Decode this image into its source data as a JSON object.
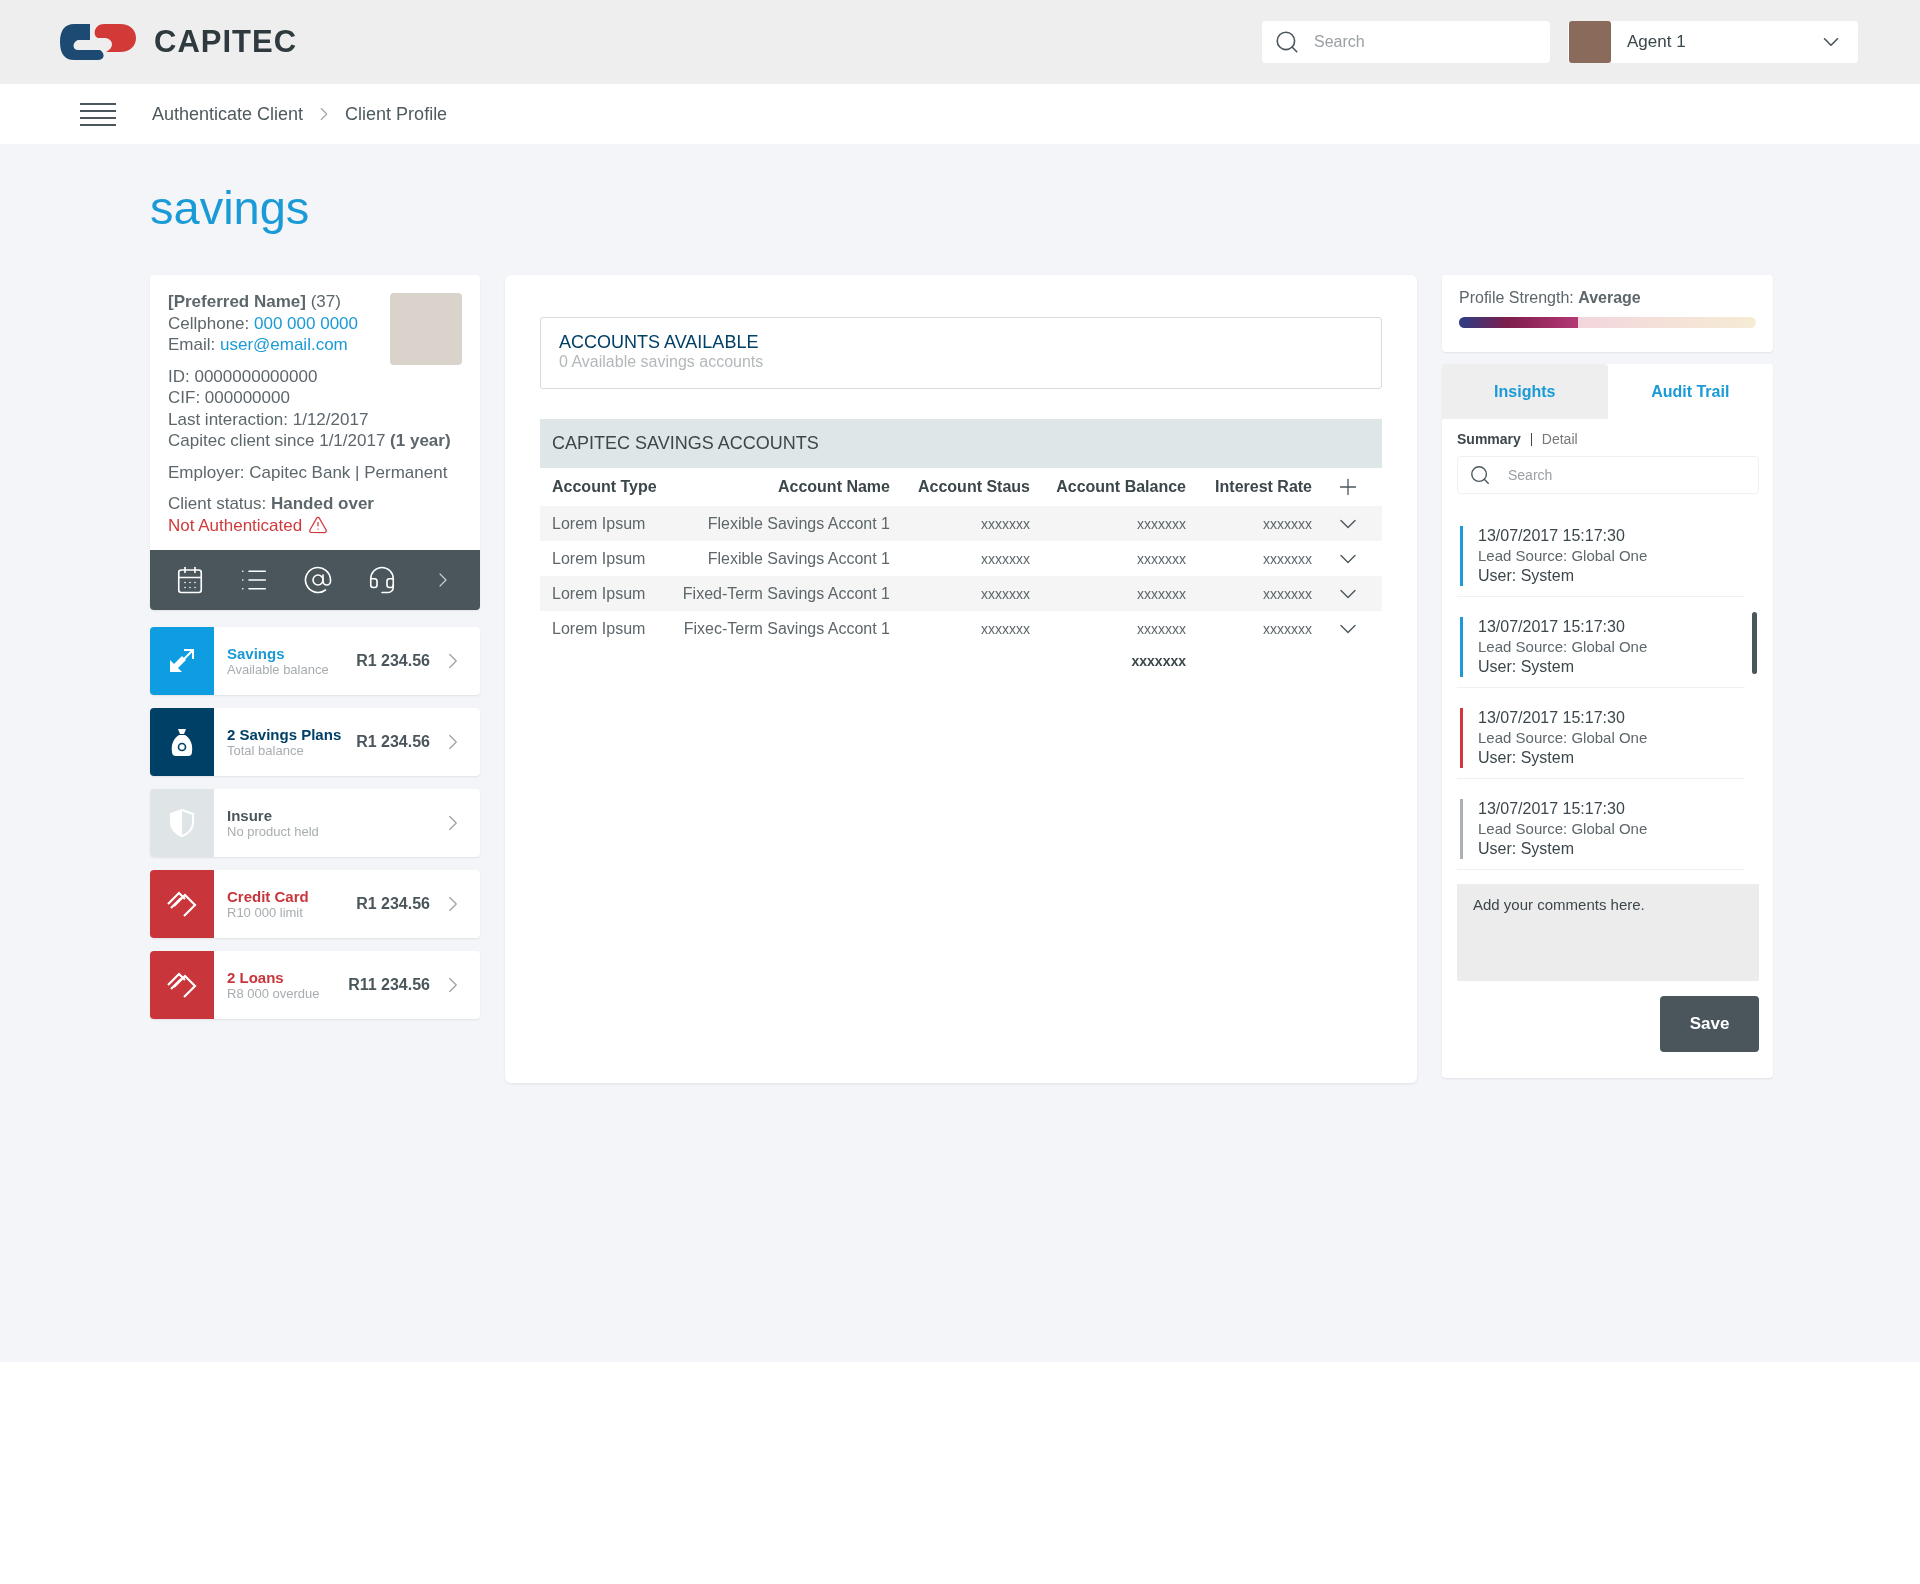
{
  "header": {
    "logo_text": "CAPITEC",
    "search": {
      "placeholder": "Search"
    },
    "agent": {
      "name": "Agent 1"
    }
  },
  "breadcrumb": [
    "Authenticate Client",
    "Client Profile"
  ],
  "page_title": "savings",
  "client": {
    "name_line": "**[Preferred Name]** (37)",
    "contacts": [
      {
        "label": "Cellphone:",
        "value": "000 000 0000"
      },
      {
        "label": "Email:",
        "value": "user@email.com"
      }
    ],
    "details": [
      "ID: 0000000000000",
      "CIF: 000000000",
      "Last interaction: 1/12/2017",
      "Capitec client since 1/1/2017 **(1 year)**"
    ],
    "employer": "Employer: Capitec Bank | Permanent",
    "status": "Client status: **Handed over**",
    "authenticated": false,
    "auth_text": "Not Authenticated"
  },
  "products": [
    {
      "kind": "savings",
      "color": "#0d9de0",
      "title": "Savings",
      "subtitle": "Available balance",
      "amount": "R1 234.56"
    },
    {
      "kind": "plans",
      "color": "#003f66",
      "title": "2 Savings Plans",
      "subtitle": "Total balance",
      "amount": "R1 234.56"
    },
    {
      "kind": "insure",
      "color": "#dfe5e7",
      "title": "Insure",
      "subtitle": "No product held"
    },
    {
      "kind": "card",
      "color": "#c8353a",
      "title": "Credit Card",
      "subtitle": "R10 000 limit",
      "amount": "R1 234.56"
    },
    {
      "kind": "loan",
      "color": "#c8353a",
      "title": "2 Loans",
      "subtitle": "R8 000 overdue",
      "amount": "R11 234.56"
    }
  ],
  "accounts_available": {
    "title": "ACCOUNTS AVAILABLE",
    "subtitle": "0 Available savings accounts"
  },
  "table": {
    "title": "CAPITEC SAVINGS ACCOUNTS",
    "columns": [
      "Account Type",
      "Account Name",
      "Account Staus",
      "Account Balance",
      "Interest Rate"
    ],
    "rows": [
      {
        "cells": [
          "Lorem Ipsum",
          "Flexible Savings Accont 1",
          "xxxxxxx",
          "xxxxxxx",
          "xxxxxxx"
        ]
      },
      {
        "cells": [
          "Lorem Ipsum",
          "Flexible Savings Accont 1",
          "xxxxxxx",
          "xxxxxxx",
          "xxxxxxx"
        ]
      },
      {
        "cells": [
          "Lorem Ipsum",
          "Fixed-Term Savings Accont 1",
          "xxxxxxx",
          "xxxxxxx",
          "xxxxxxx"
        ]
      },
      {
        "cells": [
          "Lorem Ipsum",
          "Fixec-Term Savings Accont 1",
          "xxxxxxx",
          "xxxxxxx",
          "xxxxxxx"
        ]
      }
    ],
    "total": "xxxxxxx"
  },
  "profile_strength": {
    "label": "Profile Strength: **Average**",
    "level": 0.4
  },
  "tabs": [
    {
      "label": "Insights",
      "selected": false
    },
    {
      "label": "Audit Trail",
      "selected": true
    }
  ],
  "views": [
    {
      "label": "Summary",
      "selected": true
    },
    {
      "label": "Detail",
      "selected": false
    }
  ],
  "audit_search": {
    "placeholder": "Search"
  },
  "audit_entries": [
    {
      "color": "#1a9ad6",
      "timestamp": "13/07/2017  15:17:30",
      "source": "Lead Source: Global One",
      "user": "User: System"
    },
    {
      "color": "#1a9ad6",
      "timestamp": "13/07/2017  15:17:30",
      "source": "Lead Source: Global One",
      "user": "User: System"
    },
    {
      "color": "#d0393b",
      "timestamp": "13/07/2017  15:17:30",
      "source": "Lead Source: Global One",
      "user": "User: System"
    },
    {
      "color": "#a9b1b4",
      "timestamp": "13/07/2017  15:17:30",
      "source": "Lead Source: Global One",
      "user": "User: System"
    }
  ],
  "comment": {
    "placeholder": "Add your comments here."
  },
  "save_button": "Save"
}
